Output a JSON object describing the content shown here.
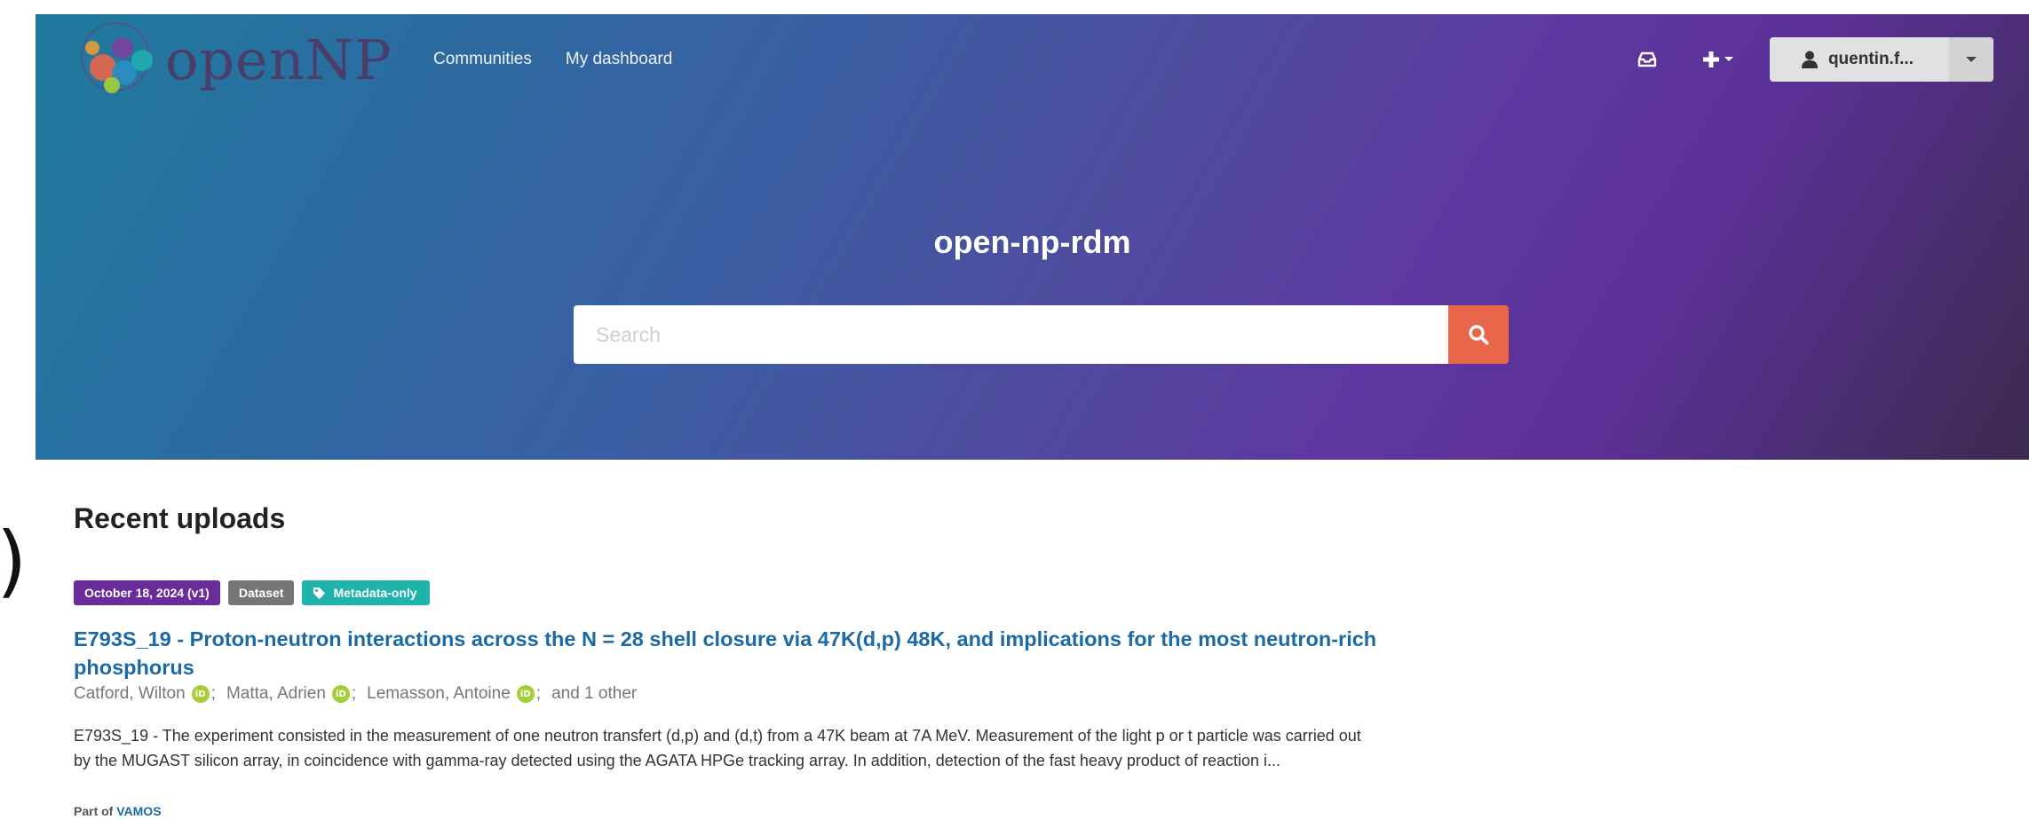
{
  "artifact": {
    "text": ")"
  },
  "header": {
    "logo_text": "openNP",
    "nav": [
      {
        "label": "Communities"
      },
      {
        "label": "My dashboard"
      }
    ],
    "user": {
      "name": "quentin.f..."
    }
  },
  "hero": {
    "title": "open-np-rdm",
    "search": {
      "placeholder": "Search"
    }
  },
  "recent": {
    "heading": "Recent uploads",
    "records": [
      {
        "date_badge": "October 18, 2024 (v1)",
        "type_badge": "Dataset",
        "access_badge": "Metadata-only",
        "title": "E793S_19 - Proton-neutron interactions across the N = 28 shell closure via 47K(d,p) 48K, and implications for the most neutron-rich phosphorus",
        "creators": [
          {
            "name": "Catford, Wilton"
          },
          {
            "name": "Matta, Adrien"
          },
          {
            "name": "Lemasson, Antoine"
          }
        ],
        "others": "and 1 other",
        "description": "E793S_19 - The experiment consisted in the measurement of one neutron transfert (d,p) and (d,t) from a 47K beam at 7A MeV. Measurement of the light p or t particle was carried out by the MUGAST silicon array, in coincidence with gamma-ray detected using the AGATA HPGe tracking array. In addition, detection of the fast heavy product of reaction i...",
        "part_of_label": "Part of",
        "community": "VAMOS"
      }
    ]
  },
  "colors": {
    "date_badge": "#6a2c9a",
    "type_badge": "#767676",
    "access_badge": "#1fb3ab",
    "link": "#1b6aa5",
    "search_button": "#e8664a",
    "orcid": "#a6ce39"
  }
}
